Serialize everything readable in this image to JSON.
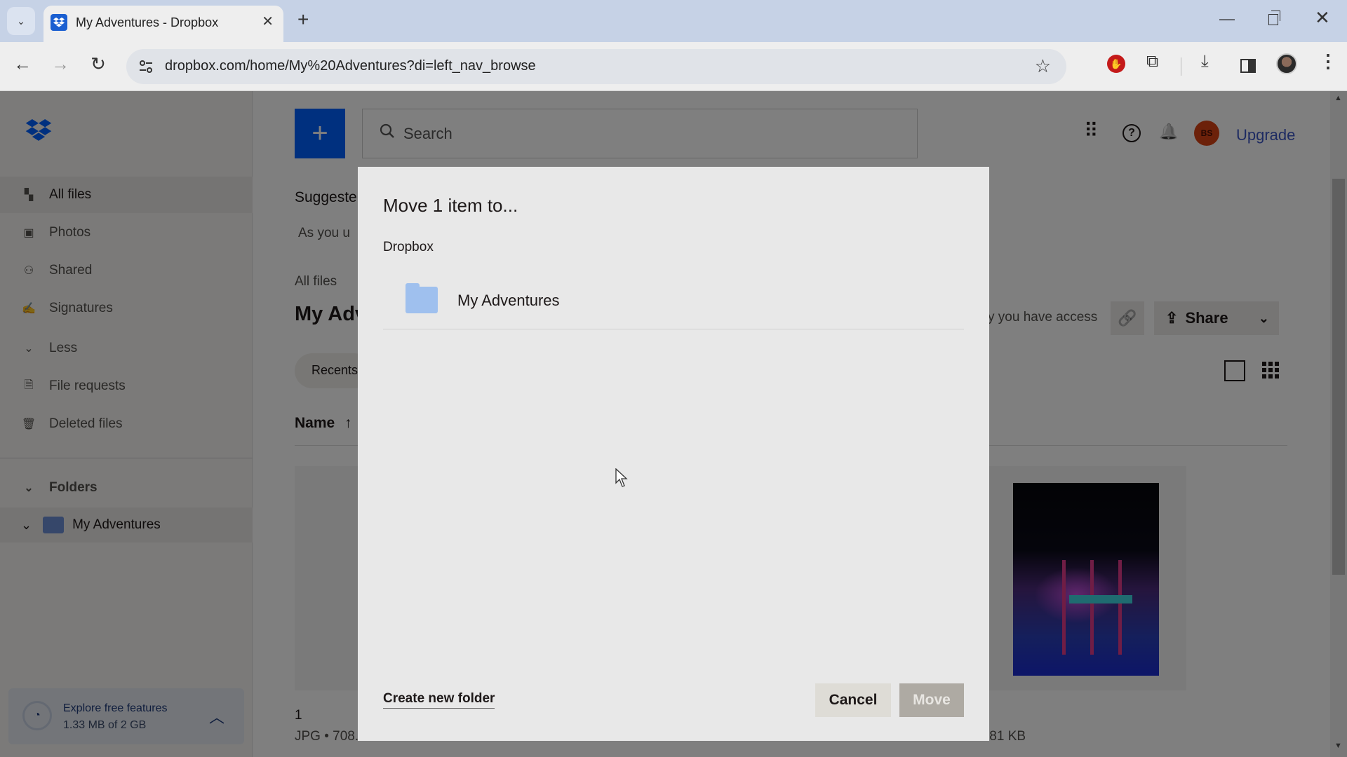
{
  "browser": {
    "tab_title": "My Adventures - Dropbox",
    "url": "dropbox.com/home/My%20Adventures?di=left_nav_browse",
    "icons": {
      "tab_dropdown": "chevron-down-icon",
      "favicon": "dropbox-icon",
      "tab_close": "close-icon",
      "new_tab": "plus-icon",
      "back": "arrow-left-icon",
      "forward": "arrow-right-icon",
      "reload": "reload-icon",
      "site_info": "tune-icon",
      "bookmark": "star-icon",
      "adblock": "adblock-hand-icon",
      "extensions": "puzzle-icon",
      "downloads": "download-icon",
      "side_panel": "side-panel-icon",
      "profile": "profile-avatar",
      "menu": "kebab-menu-icon",
      "minimize": "minimize-icon",
      "restore": "restore-icon",
      "close_window": "close-icon"
    },
    "glyphs": {
      "chev": "⌄",
      "close": "✕",
      "plus": "+",
      "back": "←",
      "forward": "→",
      "reload": "↻",
      "star": "☆",
      "hand": "✋",
      "puzzle": "⧉",
      "download": "⤓",
      "dots": "⋮",
      "min": "—"
    }
  },
  "sidebar": {
    "items": [
      {
        "label": "All files",
        "icon": "all-files-icon",
        "glyph": "▚",
        "active": true
      },
      {
        "label": "Photos",
        "icon": "photos-icon",
        "glyph": "▣"
      },
      {
        "label": "Shared",
        "icon": "shared-icon",
        "glyph": "⚇"
      },
      {
        "label": "Signatures",
        "icon": "signatures-icon",
        "glyph": "✍"
      },
      {
        "label": "Less",
        "icon": "chevron-down-icon",
        "glyph": "⌄"
      },
      {
        "label": "File requests",
        "icon": "file-request-icon",
        "glyph": "🗎"
      },
      {
        "label": "Deleted files",
        "icon": "trash-icon",
        "glyph": "🗑"
      }
    ],
    "folders_heading": "Folders",
    "folders": [
      {
        "label": "My Adventures",
        "expanded": true
      }
    ],
    "explore": {
      "title": "Explore free features",
      "usage": "1.33 MB of 2 GB",
      "chevron": "︿"
    }
  },
  "header": {
    "create_glyph": "+",
    "search_placeholder": "Search",
    "search_glyph": "⚲",
    "apps_glyph": "⠿",
    "help_glyph": "?",
    "bell_glyph": "🔔",
    "avatar_initials": "BS",
    "avatar_color": "#d84315",
    "upgrade_label": "Upgrade"
  },
  "background": {
    "suggested_heading": "Suggeste",
    "suggested_sub": "As you u",
    "breadcrumb": "All files",
    "page_title": "My Adv",
    "access_text": "y you have access",
    "link_glyph": "🔗",
    "share_label": "Share",
    "share_glyph": "⇪",
    "share_chevron": "⌄",
    "recents_label": "Recents",
    "name_header": "Name",
    "sort_glyph": "↑",
    "files": [
      {
        "name": "1",
        "meta": "JPG • 708."
      },
      {
        "name": "",
        "meta": ""
      },
      {
        "name": "",
        "meta": ".81 KB"
      }
    ],
    "scroll_up": "▲",
    "scroll_down": "▼"
  },
  "modal": {
    "title": "Move 1 item to...",
    "breadcrumb": "Dropbox",
    "folders": [
      {
        "label": "My Adventures"
      }
    ],
    "create_folder_label": "Create new folder",
    "cancel_label": "Cancel",
    "move_label": "Move",
    "move_enabled": false
  },
  "colors": {
    "dropbox_blue": "#0061fe",
    "folder_blue": "#9fc0ee",
    "upgrade_link": "#3d57c4"
  }
}
